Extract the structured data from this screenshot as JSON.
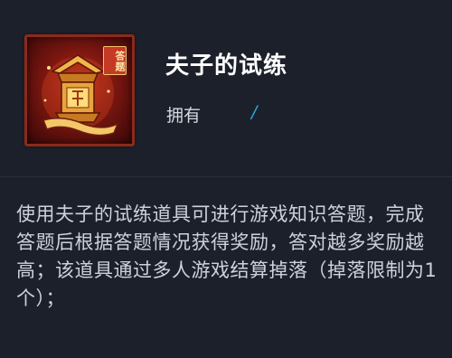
{
  "item": {
    "title": "夫子的试练",
    "badge_text": "答题",
    "owned_label": "拥有",
    "owned_value": "/",
    "icon_name": "trial-lantern-icon",
    "description": "使用夫子的试练道具可进行游戏知识答题，完成答题后根据答题情况获得奖励，答对越多奖励越高；该道具通过多人游戏结算掉落（掉落限制为1个）；"
  },
  "colors": {
    "background": "#1c202b",
    "title": "#ffffff",
    "owned_value": "#2aa6e0",
    "description": "#cdd2da",
    "icon_frame": "#8c2a1a"
  }
}
